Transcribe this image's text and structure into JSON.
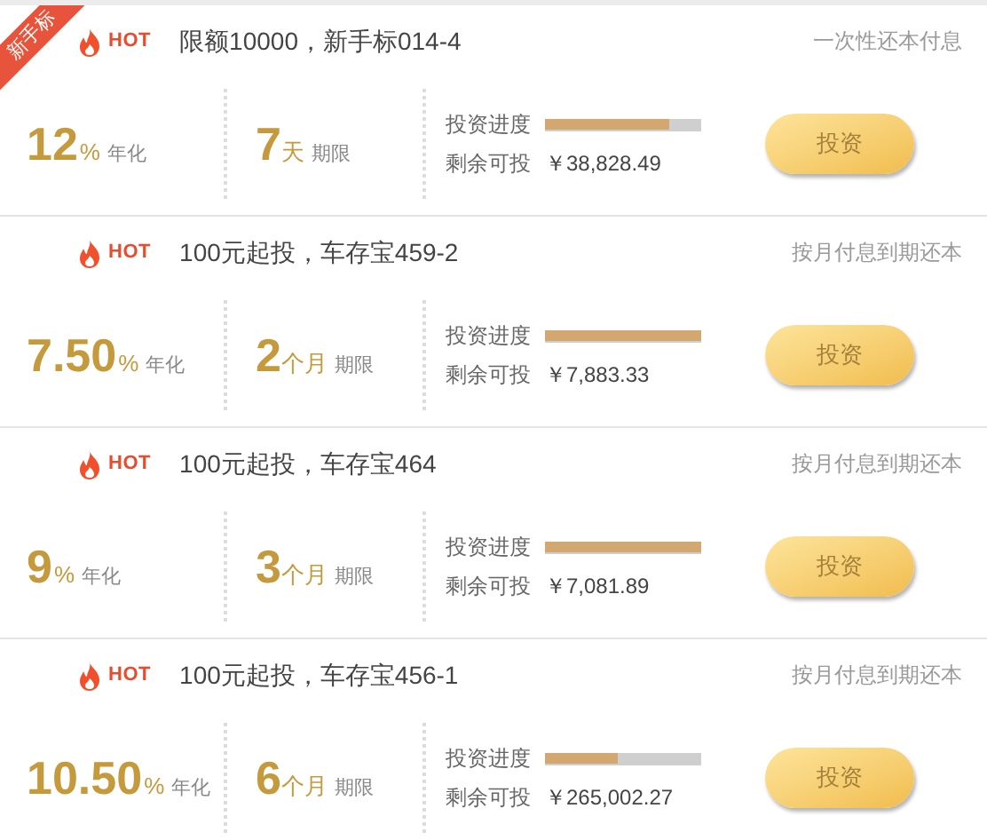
{
  "products": [
    {
      "ribbon": "新手标",
      "hot": "HOT",
      "title": "限额10000，新手标014-4",
      "repay": "一次性还本付息",
      "rate": "12",
      "rate_unit": "%",
      "rate_label": "年化",
      "term": "7",
      "term_unit": "天",
      "term_label": "期限",
      "progress_label": "投资进度",
      "level": 0.79,
      "remain_label": "剩余可投",
      "remain": "￥38,828.49",
      "button": "投资"
    },
    {
      "hot": "HOT",
      "title": "100元起投，车存宝459-2",
      "repay": "按月付息到期还本",
      "rate": "7.50",
      "rate_unit": "%",
      "rate_label": "年化",
      "term": "2",
      "term_unit": "个月",
      "term_label": "期限",
      "progress_label": "投资进度",
      "level": 1,
      "remain_label": "剩余可投",
      "remain": "￥7,883.33",
      "button": "投资"
    },
    {
      "hot": "HOT",
      "title": "100元起投，车存宝464",
      "repay": "按月付息到期还本",
      "rate": "9",
      "rate_unit": "%",
      "rate_label": "年化",
      "term": "3",
      "term_unit": "个月",
      "term_label": "期限",
      "progress_label": "投资进度",
      "level": 1,
      "remain_label": "剩余可投",
      "remain": "￥7,081.89",
      "button": "投资"
    },
    {
      "hot": "HOT",
      "title": "100元起投，车存宝456-1",
      "repay": "按月付息到期还本",
      "rate": "10.50",
      "rate_unit": "%",
      "rate_label": "年化",
      "term": "6",
      "term_unit": "个月",
      "term_label": "期限",
      "progress_label": "投资进度",
      "level": 0.47,
      "remain_label": "剩余可投",
      "remain": "￥265,002.27",
      "button": "投资"
    }
  ]
}
